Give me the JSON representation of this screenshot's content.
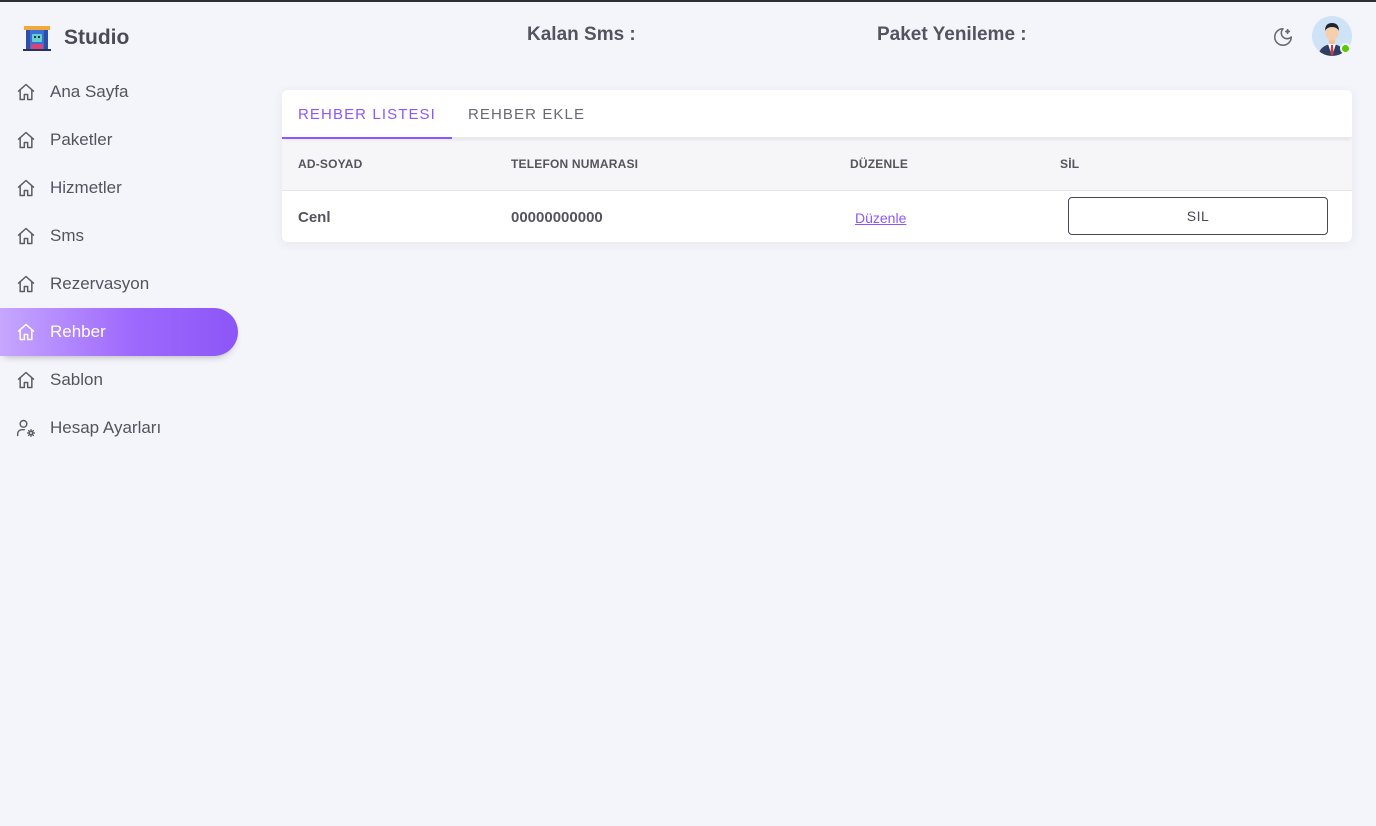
{
  "app": {
    "brand_name": "Studio",
    "accent_color": "#8c57ff"
  },
  "header": {
    "sms_label": "Kalan Sms :",
    "paket_label": "Paket Yenileme :",
    "theme_icon": "moon-star-icon",
    "avatar_status": "online"
  },
  "sidebar": {
    "items": [
      {
        "label": "Ana Sayfa",
        "icon": "home-icon"
      },
      {
        "label": "Paketler",
        "icon": "home-icon"
      },
      {
        "label": "Hizmetler",
        "icon": "home-icon"
      },
      {
        "label": "Sms",
        "icon": "home-icon"
      },
      {
        "label": "Rezervasyon",
        "icon": "home-icon"
      },
      {
        "label": "Rehber",
        "icon": "home-icon",
        "active": true
      },
      {
        "label": "Sablon",
        "icon": "home-icon"
      },
      {
        "label": "Hesap Ayarları",
        "icon": "user-gear-icon"
      }
    ]
  },
  "tabs": [
    {
      "label": "REHBER LISTESI",
      "active": true
    },
    {
      "label": "REHBER EKLE",
      "active": false
    }
  ],
  "table": {
    "headers": [
      "AD-SOYAD",
      "TELEFON NUMARASI",
      "DÜZENLE",
      "SİL"
    ],
    "rows": [
      {
        "name": "Cenl",
        "phone": "00000000000",
        "edit_label": "Düzenle",
        "delete_label": "SIL"
      }
    ]
  }
}
